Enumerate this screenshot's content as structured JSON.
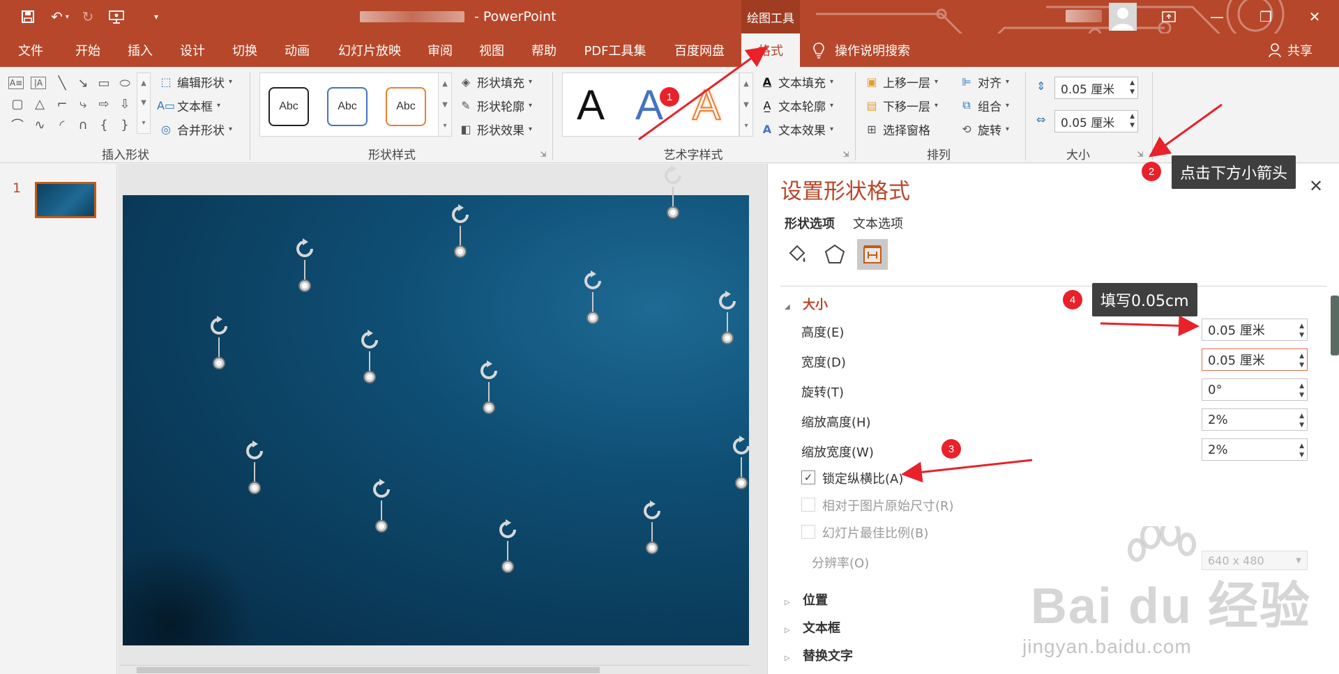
{
  "app": {
    "title_suffix": "- PowerPoint",
    "app_name": "PowerPoint",
    "contextual_tab_header": "绘图工具"
  },
  "quick_access": {
    "icons": [
      "save-icon",
      "undo-icon",
      "redo-icon",
      "present-icon",
      "customize-icon"
    ]
  },
  "tabs": [
    {
      "label": "文件"
    },
    {
      "label": "开始"
    },
    {
      "label": "插入"
    },
    {
      "label": "设计"
    },
    {
      "label": "切换"
    },
    {
      "label": "动画"
    },
    {
      "label": "幻灯片放映"
    },
    {
      "label": "审阅"
    },
    {
      "label": "视图"
    },
    {
      "label": "帮助"
    },
    {
      "label": "PDF工具集"
    },
    {
      "label": "百度网盘"
    },
    {
      "label": "格式"
    }
  ],
  "search_tab": "操作说明搜索",
  "share": "共享",
  "ribbon": {
    "insert_shapes": {
      "label": "插入形状",
      "edit_shape": "编辑形状",
      "text_box": "文本框",
      "merge_shapes": "合并形状"
    },
    "shape_styles": {
      "label": "形状样式",
      "presets": [
        "Abc",
        "Abc",
        "Abc"
      ],
      "fill": "形状填充",
      "outline": "形状轮廓",
      "effects": "形状效果"
    },
    "wordart": {
      "label": "艺术字样式",
      "glyph": "A",
      "text_fill": "文本填充",
      "text_outline": "文本轮廓",
      "text_effects": "文本效果"
    },
    "arrange": {
      "label": "排列",
      "bring_forward": "上移一层",
      "send_backward": "下移一层",
      "selection_pane": "选择窗格",
      "align": "对齐",
      "group": "组合",
      "rotate": "旋转"
    },
    "size": {
      "label": "大小",
      "height": "0.05 厘米",
      "width": "0.05 厘米"
    }
  },
  "slides": {
    "thumbnail_number": "1"
  },
  "format_pane": {
    "title": "设置形状格式",
    "tabs": [
      "形状选项",
      "文本选项"
    ],
    "size_section": "大小",
    "height_label": "高度(E)",
    "height_value": "0.05 厘米",
    "width_label": "宽度(D)",
    "width_value": "0.05 厘米",
    "rotation_label": "旋转(T)",
    "rotation_value": "0°",
    "scale_height_label": "缩放高度(H)",
    "scale_height_value": "2%",
    "scale_width_label": "缩放宽度(W)",
    "scale_width_value": "2%",
    "lock_aspect_label": "锁定纵横比(A)",
    "lock_aspect_checked": true,
    "relative_original_label": "相对于图片原始尺寸(R)",
    "best_scale_label": "幻灯片最佳比例(B)",
    "resolution_label": "分辨率(O)",
    "resolution_value": "640 x 480",
    "position_section": "位置",
    "textbox_section": "文本框",
    "alt_text_section": "替换文字"
  },
  "annotations": {
    "badges": [
      "1",
      "2",
      "3",
      "4"
    ],
    "tip_2": "点击下方小箭头",
    "tip_4": "填写0.05cm",
    "accent": "#e8212a"
  },
  "watermark": {
    "brand": "Bai du 经验",
    "url": "jingyan.baidu.com"
  },
  "colors": {
    "brand": "#b7472a",
    "slide_bg": "#0f4e74"
  }
}
